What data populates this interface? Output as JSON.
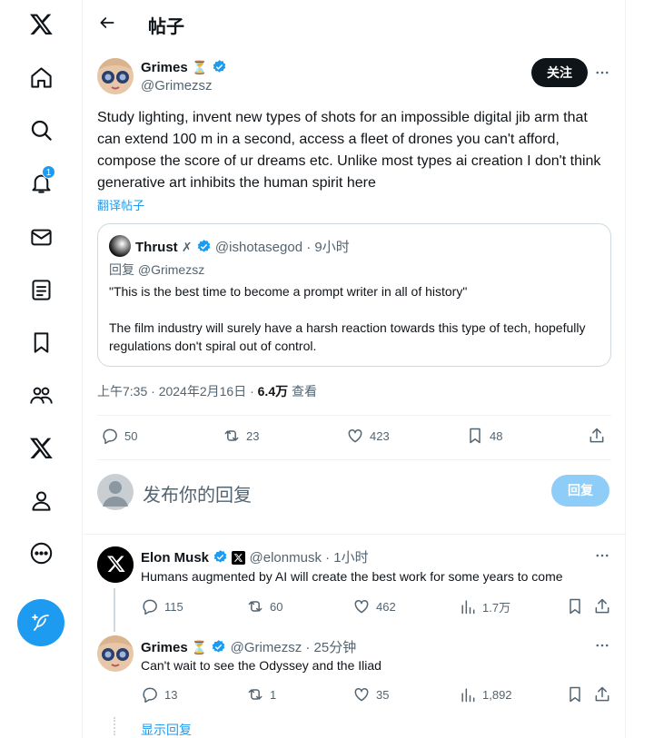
{
  "colors": {
    "accent": "#1d9bf0",
    "text": "#0f1419",
    "muted": "#536471",
    "border": "#cfd9de"
  },
  "nav": {
    "items": [
      "x-logo-icon",
      "home-icon",
      "search-icon",
      "notifications-icon",
      "messages-icon",
      "lists-icon",
      "bookmarks-icon",
      "communities-icon",
      "premium-icon",
      "profile-icon",
      "more-icon"
    ],
    "notification_count": "1"
  },
  "header": {
    "title": "帖子"
  },
  "post": {
    "author_name": "Grimes",
    "author_emoji": "⏳",
    "author_handle": "@Grimezsz",
    "follow_label": "关注",
    "text": "Study lighting, invent new types of shots for an impossible digital jib arm that can extend 100 m in a second, access a fleet of drones you can't afford, compose the score of ur dreams etc.  Unlike most types ai creation I don't think generative art inhibits the human spirit here",
    "translate_label": "翻译帖子",
    "quote": {
      "author_name": "Thrust",
      "author_handle": "@ishotasegod",
      "time": "· 9小时",
      "reply_to": "回复 @Grimezsz",
      "line1": "\"This is the best time to become a prompt writer in all of history\"",
      "line2": "The film industry will surely have a harsh  reaction towards this type of tech, hopefully regulations don't spiral out of control."
    },
    "meta_time": "上午7:35 · 2024年2月16日 · ",
    "meta_views": "6.4万",
    "meta_views_label": " 查看",
    "stats": {
      "replies": "50",
      "reposts": "23",
      "likes": "423",
      "bookmarks": "48"
    }
  },
  "reply_box": {
    "placeholder": "发布你的回复",
    "button_label": "回复"
  },
  "replies": [
    {
      "name": "Elon Musk",
      "handle": "@elonmusk",
      "time": "· 1小时",
      "text": "Humans augmented by AI will create the best work for some years to come",
      "stats": {
        "replies": "115",
        "reposts": "60",
        "likes": "462",
        "views": "1.7万"
      }
    },
    {
      "name": "Grimes",
      "emoji": "⏳",
      "handle": "@Grimezsz",
      "time": "· 25分钟",
      "text": "Can't wait to see the Odyssey and the Iliad",
      "stats": {
        "replies": "13",
        "reposts": "1",
        "likes": "35",
        "views": "1,892"
      }
    }
  ],
  "show_replies_label": "显示回复"
}
